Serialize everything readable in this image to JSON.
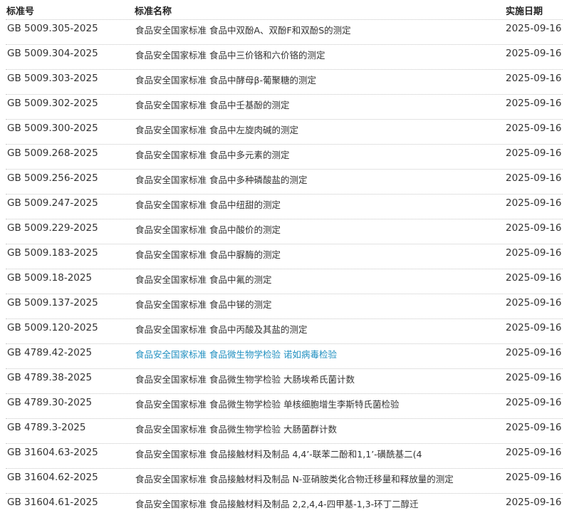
{
  "header": {
    "code": "标准号",
    "name": "标准名称",
    "date": "实施日期"
  },
  "rows": [
    {
      "code": "GB 5009.305-2025",
      "name": "食品安全国家标准 食品中双酚A、双酚F和双酚S的测定",
      "date": "2025-09-16"
    },
    {
      "code": "GB 5009.304-2025",
      "name": "食品安全国家标准 食品中三价铬和六价铬的测定",
      "date": "2025-09-16"
    },
    {
      "code": "GB 5009.303-2025",
      "name": "食品安全国家标准 食品中酵母β-葡聚糖的测定",
      "date": "2025-09-16"
    },
    {
      "code": "GB 5009.302-2025",
      "name": "食品安全国家标准 食品中壬基酚的测定",
      "date": "2025-09-16"
    },
    {
      "code": "GB 5009.300-2025",
      "name": "食品安全国家标准 食品中左旋肉碱的测定",
      "date": "2025-09-16"
    },
    {
      "code": "GB 5009.268-2025",
      "name": "食品安全国家标准 食品中多元素的测定",
      "date": "2025-09-16"
    },
    {
      "code": "GB 5009.256-2025",
      "name": "食品安全国家标准 食品中多种磷酸盐的测定",
      "date": "2025-09-16"
    },
    {
      "code": "GB 5009.247-2025",
      "name": "食品安全国家标准 食品中纽甜的测定",
      "date": "2025-09-16"
    },
    {
      "code": "GB 5009.229-2025",
      "name": "食品安全国家标准 食品中酸价的测定",
      "date": "2025-09-16"
    },
    {
      "code": "GB 5009.183-2025",
      "name": "食品安全国家标准 食品中脲酶的测定",
      "date": "2025-09-16"
    },
    {
      "code": "GB 5009.18-2025",
      "name": "食品安全国家标准 食品中氟的测定",
      "date": "2025-09-16"
    },
    {
      "code": "GB 5009.137-2025",
      "name": "食品安全国家标准 食品中锑的测定",
      "date": "2025-09-16"
    },
    {
      "code": "GB 5009.120-2025",
      "name": "食品安全国家标准 食品中丙酸及其盐的测定",
      "date": "2025-09-16"
    },
    {
      "code": "GB 4789.42-2025",
      "name": "食品安全国家标准 食品微生物学检验 诺如病毒检验",
      "date": "2025-09-16",
      "active": true
    },
    {
      "code": "GB 4789.38-2025",
      "name": "食品安全国家标准 食品微生物学检验 大肠埃希氏菌计数",
      "date": "2025-09-16"
    },
    {
      "code": "GB 4789.30-2025",
      "name": "食品安全国家标准 食品微生物学检验 单核细胞增生李斯特氏菌检验",
      "date": "2025-09-16"
    },
    {
      "code": "GB 4789.3-2025",
      "name": "食品安全国家标准 食品微生物学检验 大肠菌群计数",
      "date": "2025-09-16"
    },
    {
      "code": "GB 31604.63-2025",
      "name": "食品安全国家标准 食品接触材料及制品 4,4’-联苯二酚和1,1’-磺酰基二(4",
      "date": "2025-09-16"
    },
    {
      "code": "GB 31604.62-2025",
      "name": "食品安全国家标准 食品接触材料及制品 N-亚硝胺类化合物迁移量和释放量的测定",
      "date": "2025-09-16"
    },
    {
      "code": "GB 31604.61-2025",
      "name": "食品安全国家标准 食品接触材料及制品 2,2,4,4-四甲基-1,3-环丁二醇迁",
      "date": "2025-09-16"
    }
  ]
}
